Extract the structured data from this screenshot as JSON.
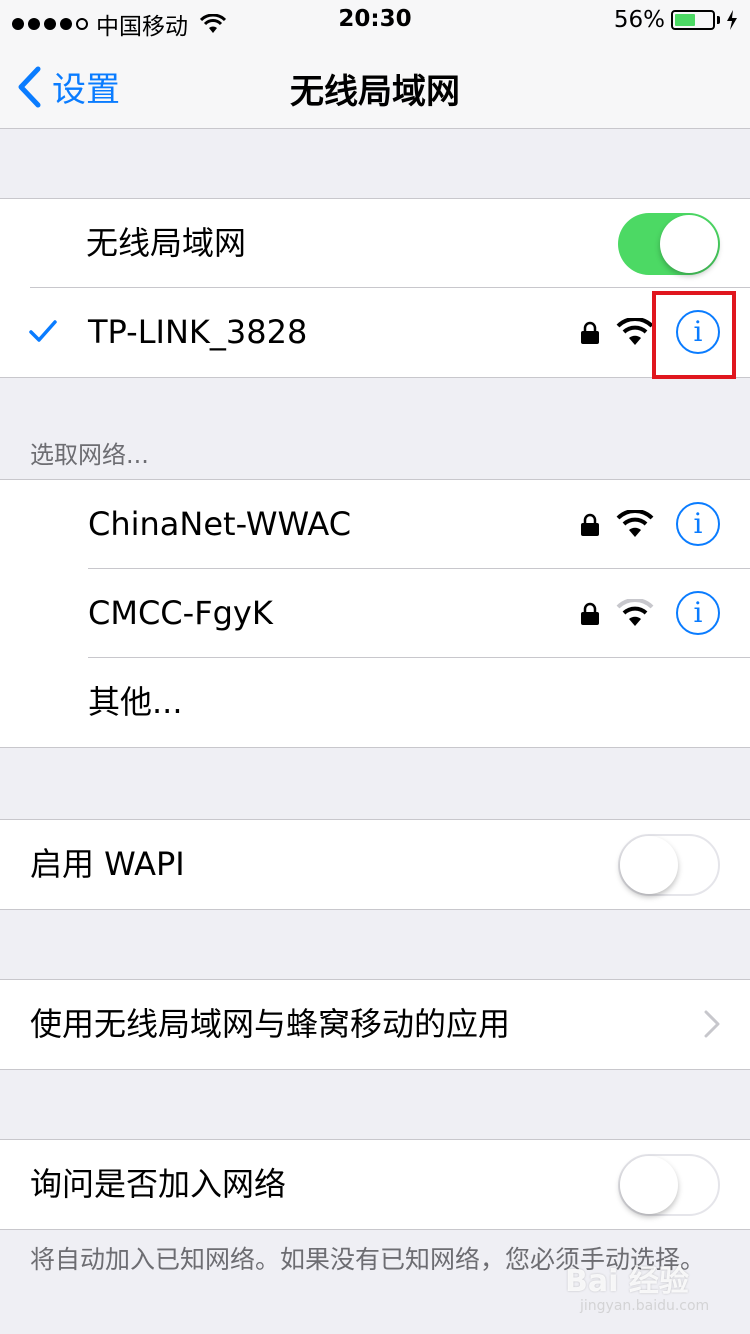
{
  "status_bar": {
    "carrier": "中国移动",
    "time": "20:30",
    "battery_percent": "56%",
    "battery_level": 0.56,
    "battery_color": "#4cd964"
  },
  "nav": {
    "back_label": "设置",
    "title": "无线局域网"
  },
  "wifi_toggle": {
    "label": "无线局域网",
    "on": true
  },
  "connected_network": {
    "name": "TP-LINK_3828",
    "secured": true,
    "signal": "full"
  },
  "choose_network_header": "选取网络...",
  "networks": [
    {
      "name": "ChinaNet-WWAC",
      "secured": true,
      "signal": "full"
    },
    {
      "name": "CMCC-FgyK",
      "secured": true,
      "signal": "medium"
    }
  ],
  "other_label": "其他...",
  "wapi": {
    "label": "启用 WAPI",
    "on": false
  },
  "apps_row": {
    "label": "使用无线局域网与蜂窝移动的应用"
  },
  "ask_join": {
    "label": "询问是否加入网络",
    "on": false
  },
  "footer_note": "将自动加入已知网络。如果没有已知网络，您必须手动选择。",
  "watermark": "Bai 经验",
  "watermark_sub": "jingyan.baidu.com",
  "colors": {
    "accent": "#0a7cff",
    "highlight": "#e0161e",
    "toggle_on": "#4cd964"
  }
}
